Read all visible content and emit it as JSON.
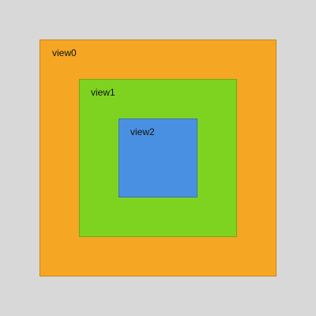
{
  "views": [
    {
      "label": "view0",
      "color": "#f5a623"
    },
    {
      "label": "view1",
      "color": "#7ed321"
    },
    {
      "label": "view2",
      "color": "#4a90e2"
    }
  ],
  "background_color": "#d8d8d8"
}
